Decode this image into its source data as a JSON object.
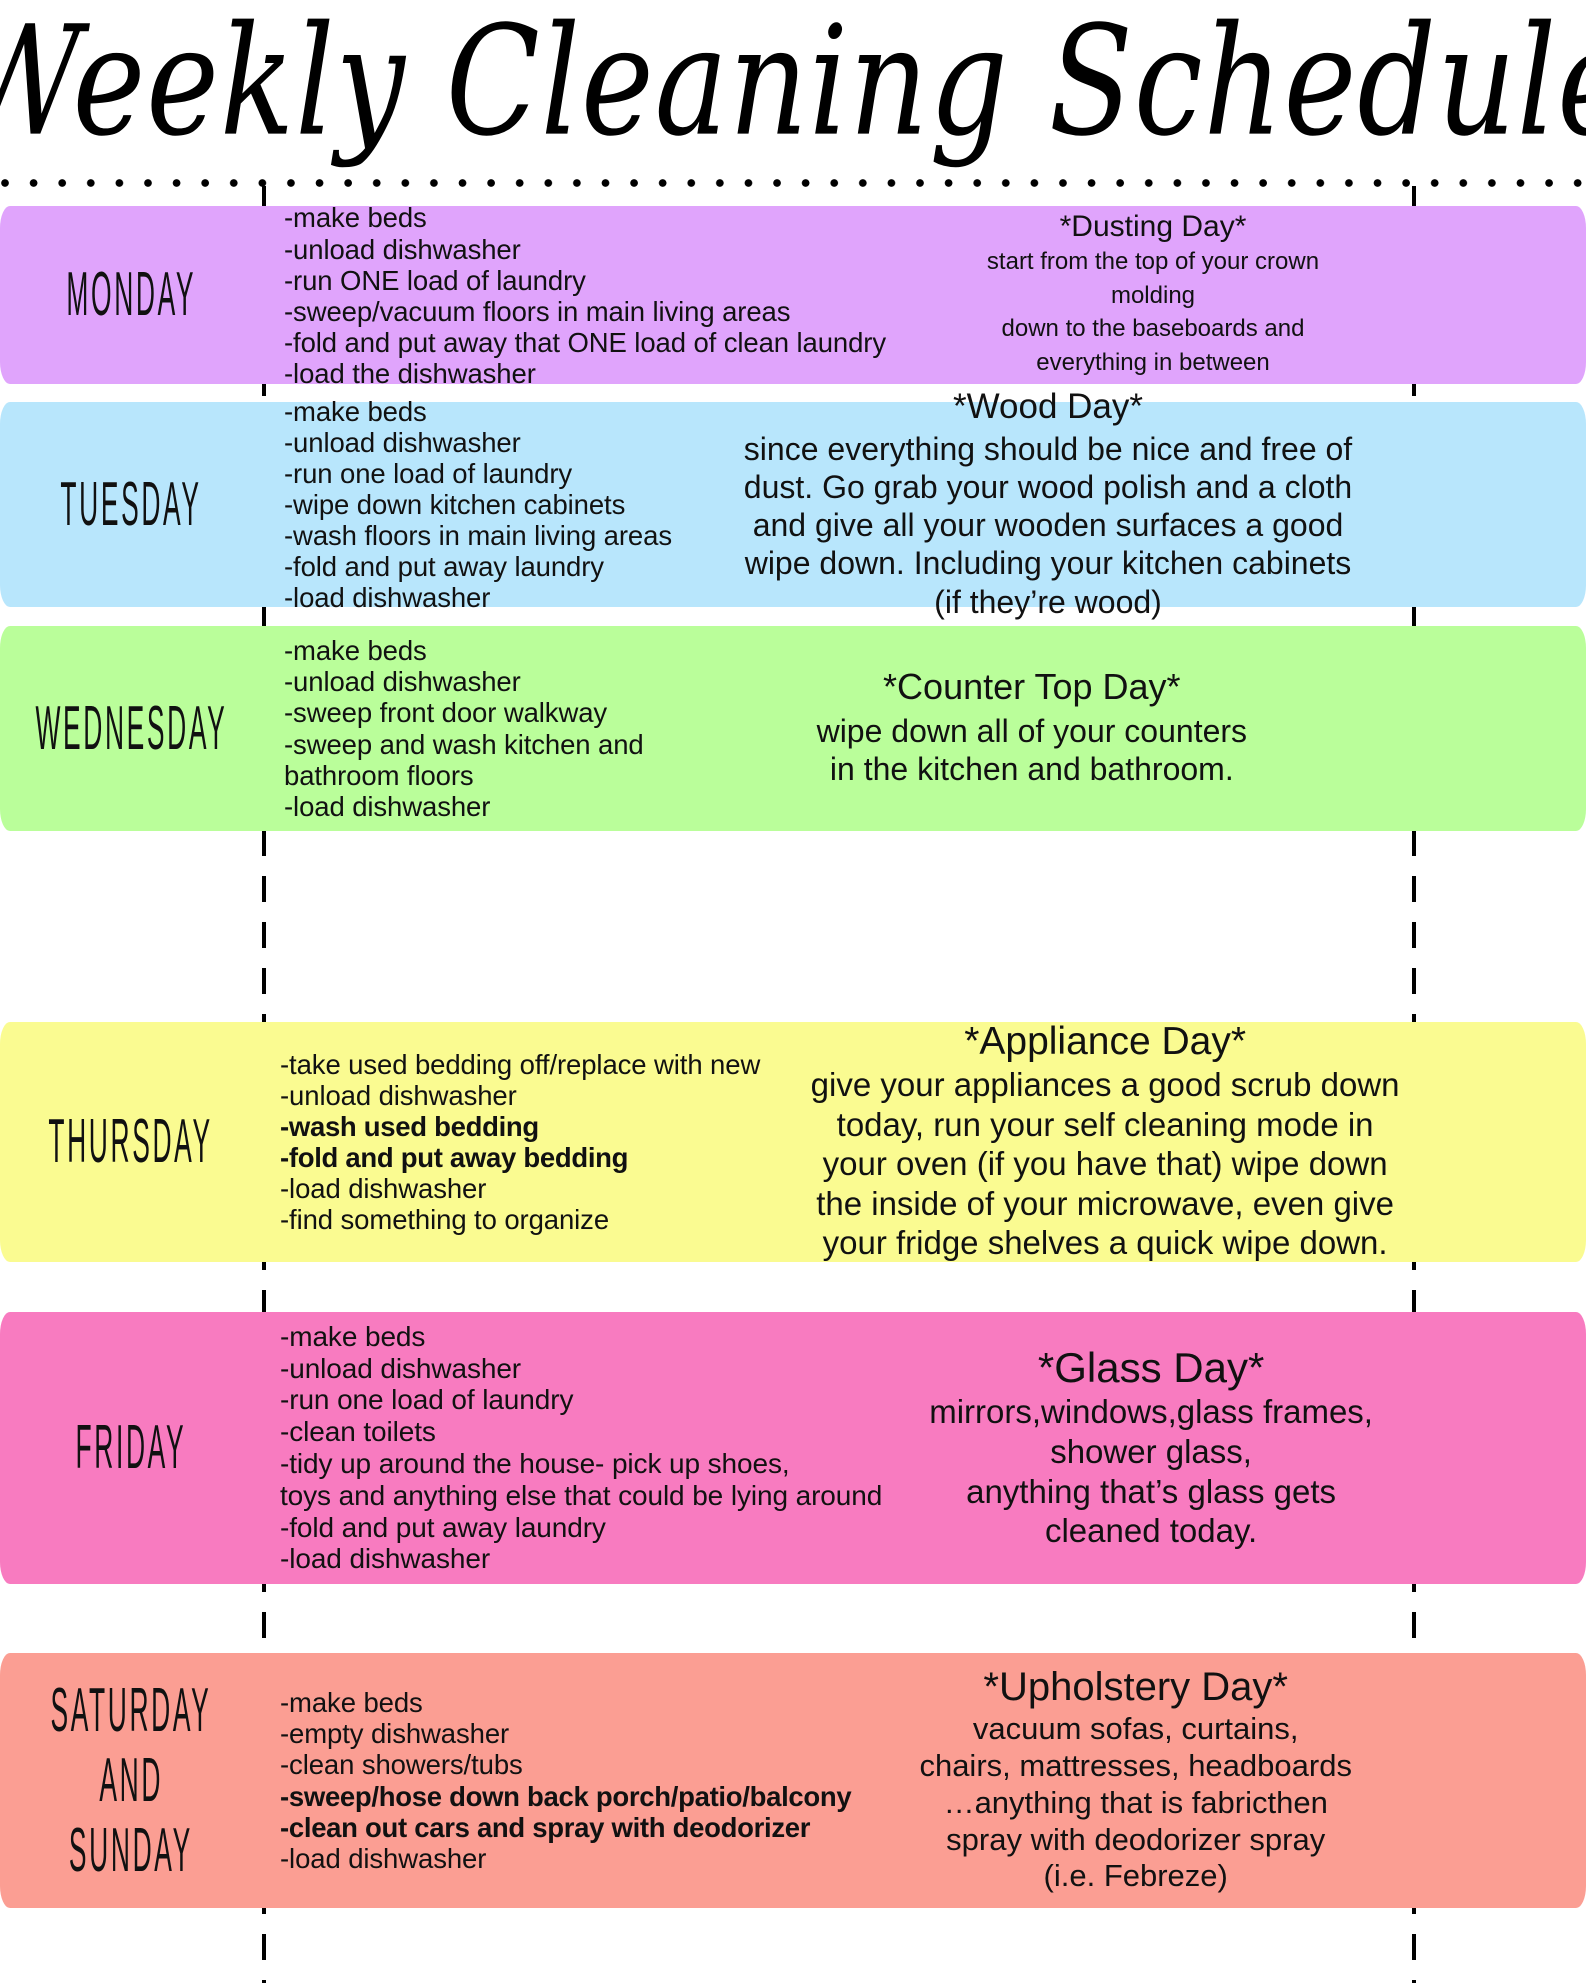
{
  "header": {
    "title": "Weekly Cleaning Schedule"
  },
  "colors": {
    "monday": "#E0A4FC",
    "tuesday": "#B8E6FC",
    "wednesday": "#BAFE9A",
    "thursday": "#FAFB91",
    "friday": "#F87BC0",
    "weekend": "#FB9E93",
    "text": "#111111",
    "page_background": "#FFFFFF"
  },
  "days": [
    {
      "id": "monday",
      "name": "MONDAY",
      "tasks": [
        {
          "text": "-make beds",
          "bold": false
        },
        {
          "text": "-unload dishwasher",
          "bold": false
        },
        {
          "text": "-run ONE load of laundry",
          "bold": false
        },
        {
          "text": "-sweep/vacuum floors in main living areas",
          "bold": false
        },
        {
          "text": "-fold and put away that ONE load of clean laundry",
          "bold": false
        },
        {
          "text": "-load the dishwasher",
          "bold": false
        }
      ],
      "focus_title": "*Dusting Day*",
      "focus_lines": [
        "start from the top of your crown",
        "molding",
        "down to the baseboards and",
        "everything in between"
      ]
    },
    {
      "id": "tuesday",
      "name": "TUESDAY",
      "tasks": [
        {
          "text": "-make beds",
          "bold": false
        },
        {
          "text": "-unload dishwasher",
          "bold": false
        },
        {
          "text": "-run one load of laundry",
          "bold": false
        },
        {
          "text": "-wipe down kitchen cabinets",
          "bold": false
        },
        {
          "text": "-wash floors in main living areas",
          "bold": false
        },
        {
          "text": "-fold and put away laundry",
          "bold": false
        },
        {
          "text": "-load dishwasher",
          "bold": false
        }
      ],
      "focus_title": "*Wood Day*",
      "focus_lines": [
        "since everything should be nice and free of",
        "dust. Go grab your wood polish and a cloth",
        "and give all your wooden surfaces a good",
        "wipe down. Including your kitchen cabinets",
        "(if they’re wood)"
      ]
    },
    {
      "id": "wednesday",
      "name": "WEDNESDAY",
      "tasks": [
        {
          "text": "-make beds",
          "bold": false
        },
        {
          "text": "-unload dishwasher",
          "bold": false
        },
        {
          "text": "-sweep front door walkway",
          "bold": false
        },
        {
          "text": "-sweep and wash kitchen and",
          "bold": false
        },
        {
          "text": " bathroom floors",
          "bold": false
        },
        {
          "text": "-load dishwasher",
          "bold": false
        }
      ],
      "focus_title": "*Counter Top Day*",
      "focus_lines": [
        "wipe down all of your counters",
        "in the kitchen and bathroom."
      ]
    },
    {
      "id": "thursday",
      "name": "THURSDAY",
      "tasks": [
        {
          "text": "-take used bedding off/replace with new",
          "bold": false
        },
        {
          "text": "-unload dishwasher",
          "bold": false
        },
        {
          "text": "-wash used bedding",
          "bold": true
        },
        {
          "text": "-fold and put away bedding",
          "bold": true
        },
        {
          "text": "-load dishwasher",
          "bold": false
        },
        {
          "text": "-find something to organize",
          "bold": false
        }
      ],
      "focus_title": "*Appliance Day*",
      "focus_lines": [
        "give your appliances a good scrub down",
        "today, run your self cleaning mode in",
        "your oven (if you have that) wipe down",
        "the inside of your microwave, even give",
        "your fridge shelves a quick wipe down."
      ]
    },
    {
      "id": "friday",
      "name": "FRIDAY",
      "tasks": [
        {
          "text": "-make beds",
          "bold": false
        },
        {
          "text": "-unload dishwasher",
          "bold": false
        },
        {
          "text": "-run one load of laundry",
          "bold": false
        },
        {
          "text": "-clean toilets",
          "bold": false
        },
        {
          "text": "-tidy up around the house- pick up shoes,",
          "bold": false
        },
        {
          "text": "toys and anything else that could be lying around",
          "bold": false
        },
        {
          "text": "-fold and put away laundry",
          "bold": false
        },
        {
          "text": "-load dishwasher",
          "bold": false
        }
      ],
      "focus_title": "*Glass Day*",
      "focus_lines": [
        "mirrors,windows,glass frames,",
        "shower glass,",
        "anything that’s glass gets",
        "cleaned today."
      ]
    },
    {
      "id": "weekend",
      "name": "SATURDAY AND SUNDAY",
      "name_lines": [
        "SATURDAY",
        "AND",
        "SUNDAY"
      ],
      "tasks": [
        {
          "text": "-make beds",
          "bold": false
        },
        {
          "text": "-empty dishwasher",
          "bold": false
        },
        {
          "text": "-clean showers/tubs",
          "bold": false
        },
        {
          "text": "-sweep/hose down back porch/patio/balcony",
          "bold": true
        },
        {
          "text": "-clean out cars and spray with deodorizer",
          "bold": true
        },
        {
          "text": "-load dishwasher",
          "bold": false
        }
      ],
      "focus_title": "*Upholstery Day*",
      "focus_lines": [
        "vacuum sofas, curtains,",
        "chairs, mattresses, headboards",
        "…anything that is fabricthen",
        "spray with deodorizer spray",
        "(i.e. Febreze)"
      ]
    }
  ]
}
